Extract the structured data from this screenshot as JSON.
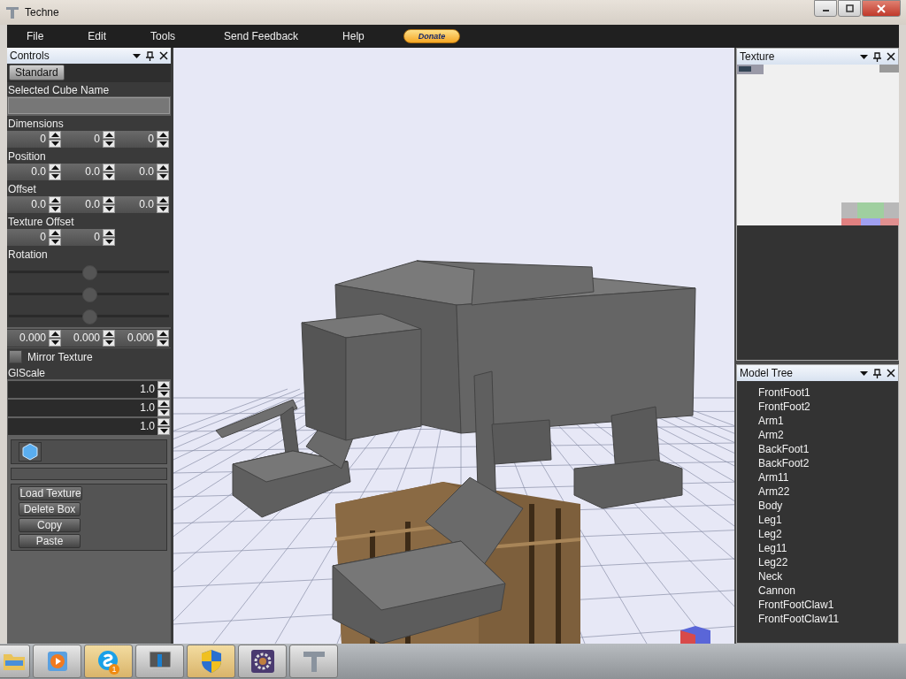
{
  "window": {
    "title": "Techne"
  },
  "menu": [
    {
      "label": "File"
    },
    {
      "label": "Edit"
    },
    {
      "label": "Tools"
    },
    {
      "label": "Send Feedback"
    },
    {
      "label": "Help"
    }
  ],
  "donate": {
    "label": "Donate"
  },
  "controls": {
    "title": "Controls",
    "tab": "Standard",
    "cube_name": {
      "label": "Selected Cube Name"
    },
    "groups": [
      {
        "label": "Dimensions",
        "values": [
          "0",
          "0",
          "0"
        ]
      },
      {
        "label": "Position",
        "values": [
          "0.0",
          "0.0",
          "0.0"
        ]
      },
      {
        "label": "Offset",
        "values": [
          "0.0",
          "0.0",
          "0.0"
        ]
      },
      {
        "label": "Texture Offset",
        "values": [
          "0",
          "0"
        ]
      }
    ],
    "rotation": {
      "label": "Rotation",
      "sliders": [
        {
          "level": 0.5
        },
        {
          "level": 0.5
        },
        {
          "level": 0.5
        }
      ],
      "values": [
        "0.000",
        "0.000",
        "0.000"
      ]
    },
    "mirror_texture": {
      "label": "Mirror Texture",
      "checked": false
    },
    "glscale": {
      "label": "GlScale",
      "values": [
        "1.0",
        "1.0",
        "1.0"
      ]
    },
    "actions": [
      "Load Texture",
      "Delete Box",
      "Copy",
      "Paste"
    ]
  },
  "texture_panel": {
    "title": "Texture"
  },
  "model_tree": {
    "title": "Model Tree",
    "items": [
      "FrontFoot1",
      "FrontFoot2",
      "Arm1",
      "Arm2",
      "BackFoot1",
      "BackFoot2",
      "Arm11",
      "Arm22",
      "Body",
      "Leg1",
      "Leg2",
      "Leg11",
      "Leg22",
      "Neck",
      "Cannon",
      "FrontFootClaw1",
      "FrontFootClaw11"
    ]
  },
  "taskbar": [
    {
      "kind": "folder",
      "highlighted": false
    },
    {
      "kind": "media",
      "highlighted": false
    },
    {
      "kind": "chat",
      "highlighted": true,
      "badge": "1"
    },
    {
      "kind": "monitor",
      "highlighted": false
    },
    {
      "kind": "shield",
      "highlighted": true
    },
    {
      "kind": "gear",
      "highlighted": false
    },
    {
      "kind": "app",
      "highlighted": false
    }
  ]
}
